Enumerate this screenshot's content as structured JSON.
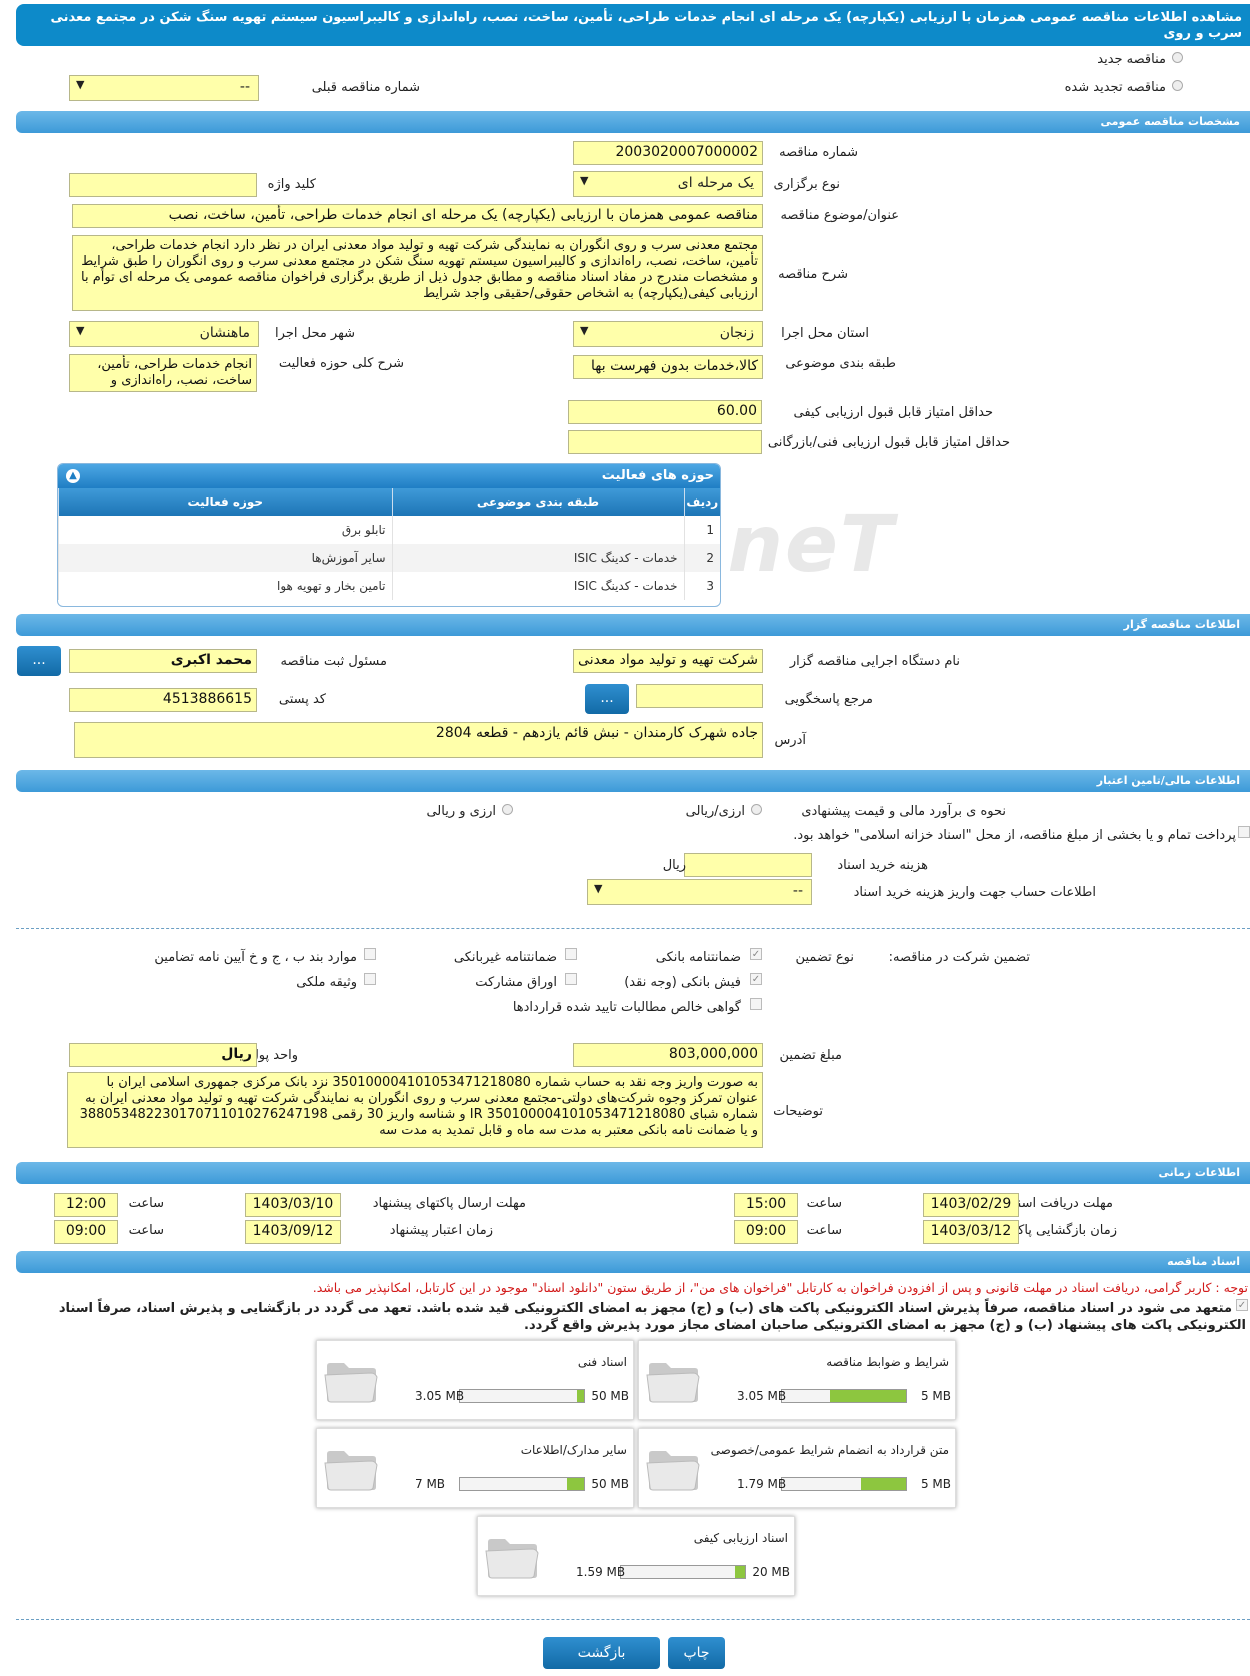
{
  "title": "مشاهده اطلاعات مناقصه عمومی همزمان با ارزیابی (یکپارچه) یک مرحله ای انجام خدمات طراحی، تأمین، ساخت، نصب، راه‌اندازی و کالیبراسیون سیستم تهویه سنگ شکن در مجتمع معدنی سرب و روی",
  "top": {
    "new_tender": "مناقصه جدید",
    "renewed_tender": "مناقصه تجدید شده",
    "prev_number_label": "شماره مناقصه قبلی",
    "prev_number_value": "--"
  },
  "general": {
    "section_title": "مشخصات مناقصه عمومی",
    "number_label": "شماره مناقصه",
    "number_value": "2003020007000002",
    "type_label": "نوع برگزاری",
    "type_value": "یک مرحله ای",
    "keyword_label": "کلید واژه",
    "keyword_value": "",
    "subject_label": "عنوان/موضوع مناقصه",
    "subject_value": "مناقصه عمومی همزمان با ارزیابی (یکپارچه) یک مرحله ای انجام خدمات طراحی، تأمین، ساخت، نصب",
    "desc_label": "شرح مناقصه",
    "desc_value": "مجتمع معدنی سرب و روی انگوران به نمایندگی شرکت تهیه و تولید مواد معدنی ایران در نظر دارد انجام خدمات طراحی، تأمین، ساخت، نصب، راه‌اندازی و کالیبراسیون سیستم تهویه سنگ شکن در مجتمع معدنی سرب و روی انگوران را طبق شرایط و مشخصات مندرج در مفاد اسناد مناقصه و مطابق جدول ذیل از طریق برگزاری فراخوان مناقصه عمومی یک مرحله ای توأم با ارزیابی کیفی(یکپارچه) به اشخاص حقوقی/حقیقی واجد شرایط",
    "province_label": "استان محل اجرا",
    "province_value": "زنجان",
    "city_label": "شهر محل اجرا",
    "city_value": "ماهنشان",
    "category_label": "طبقه بندی موضوعی",
    "category_value": "کالا،خدمات بدون فهرست بها",
    "activity_label": "شرح کلی حوزه فعالیت",
    "activity_value": "انجام خدمات طراحی، تأمین، ساخت، نصب، راه‌اندازی و",
    "quality_label": "حداقل امتیاز قابل قبول ارزیابی کیفی",
    "quality_value": "60.00",
    "tech_label": "حداقل امتیاز قابل قبول ارزیابی فنی/بازرگانی",
    "tech_value": ""
  },
  "activities": {
    "title": "حوزه های فعالیت",
    "headers": [
      "ردیف",
      "طبقه بندی موضوعی",
      "حوزه فعالیت"
    ],
    "rows": [
      [
        "1",
        "",
        "تابلو برق"
      ],
      [
        "2",
        "خدمات - کدینگ ISIC",
        "سایر آموزش‌ها"
      ],
      [
        "3",
        "خدمات - کدینگ ISIC",
        "تامین بخار و تهویه هوا"
      ]
    ]
  },
  "watermark": "AriaTender.neT",
  "org": {
    "section_title": "اطلاعات مناقصه گزار",
    "name_label": "نام دستگاه اجرایی مناقصه گزار",
    "name_value": "شرکت تهیه و تولید مواد معدنی",
    "resp_label": "مسئول ثبت مناقصه",
    "resp_value": "محمد اکبری",
    "ref_label": "مرجع پاسخگویی",
    "ref_value": "",
    "postal_label": "کد پستی",
    "postal_value": "4513886615",
    "address_label": "آدرس",
    "address_value": "جاده شهرک کارمندان - نبش قائم یازدهم - قطعه 2804",
    "dots": "..."
  },
  "finance": {
    "section_title": "اطلاعات مالی/تامین اعتبار",
    "method_label": "نحوه ی برآورد مالی و قیمت پیشنهادی",
    "opt_rial": "ارزی/ریالی",
    "opt_both": "ارزی و ریالی",
    "treasury": "پرداخت تمام و یا بخشی از مبلغ مناقصه، از محل \"اسناد خزانه اسلامی\" خواهد بود.",
    "doc_fee_label": "هزینه خرید اسناد",
    "doc_fee_value": "",
    "rial": "ریال",
    "account_label": "اطلاعات حساب جهت واریز هزینه خرید اسناد",
    "account_value": "--"
  },
  "guarantee": {
    "label": "تضمین شرکت در مناقصه:",
    "type_label": "نوع تضمین",
    "opts": [
      "ضمانتنامه بانکی",
      "ضمانتنامه غیربانکی",
      "موارد بند ب ، ج و خ آیین نامه تضامین",
      "فیش بانکی (وجه نقد)",
      "اوراق مشارکت",
      "وثیقه ملکی",
      "گواهی خالص مطالبات تایید شده قراردادها"
    ],
    "amount_label": "مبلغ تضمین",
    "amount_value": "803,000,000",
    "unit_label": "واحد پول",
    "unit_value": "ریال",
    "notes_label": "توضیحات",
    "notes_value": "به صورت واریز وجه نقد به حساب شماره 3501000041010534712180​80 نزد بانک مرکزی جمهوری اسلامی ایران با عنوان تمرکز وجوه شرکت‌های دولتی-مجتمع معدنی سرب و روی انگوران به نمایندگی شرکت تهیه و تولید مواد معدنی ایران به شماره شبای IR 350100004101053471218080 و شناسه واریز 30 رقمی 388053482230170711010276247198 و یا ضمانت نامه بانکی معتبر به مدت سه ماه و قابل تمدید به مدت سه"
  },
  "timing": {
    "section_title": "اطلاعات زمانی",
    "doc_receive_label": "مهلت دریافت اسناد",
    "doc_receive_date": "1403/02/29",
    "doc_receive_time": "15:00",
    "send_label": "مهلت ارسال پاکتهای پیشنهاد",
    "send_date": "1403/03/10",
    "send_time": "12:00",
    "open_label": "زمان بازگشایی پاکت ها",
    "open_date": "1403/03/12",
    "open_time": "09:00",
    "valid_label": "زمان اعتبار پیشنهاد",
    "valid_date": "1403/09/12",
    "valid_time": "09:00",
    "time_label": "ساعت"
  },
  "docs": {
    "section_title": "اسناد مناقصه",
    "note": "توجه : کاربر گرامی، دریافت اسناد در مهلت قانونی و پس از افزودن فراخوان به کارتابل \"فراخوان های من\"، از طریق ستون \"دانلود اسناد\" موجود در این کارتابل، امکانپذیر می باشد.",
    "commit": "متعهد می شود در اسناد مناقصه، صرفاً پذیرش اسناد الکترونیکی پاکت های (ب) و (ج) مجهز به امضای الکترونیکی قید شده باشد. تعهد می گردد در بازگشایی و پذیرش اسناد، صرفاً اسناد الکترونیکی پاکت های پیشنهاد (ب) و (ج) مجهز به امضای الکترونیکی صاحبان امضای مجاز مورد پذیرش واقع گردد.",
    "items": [
      {
        "name": "شرایط و ضوابط مناقصه",
        "max": "5 MB",
        "used": "3.05 MB",
        "ratio": 0.61
      },
      {
        "name": "اسناد فنی",
        "max": "50 MB",
        "used": "3.05 MB",
        "ratio": 0.06
      },
      {
        "name": "متن قرارداد به انضمام شرایط عمومی/خصوصی",
        "max": "5 MB",
        "used": "1.79 MB",
        "ratio": 0.36
      },
      {
        "name": "سایر مدارک/اطلاعات",
        "max": "50 MB",
        "used": "7 MB",
        "ratio": 0.14
      },
      {
        "name": "اسناد ارزیابی کیفی",
        "max": "20 MB",
        "used": "1.59 MB",
        "ratio": 0.08
      }
    ]
  },
  "buttons": {
    "print": "چاپ",
    "back": "بازگشت"
  }
}
